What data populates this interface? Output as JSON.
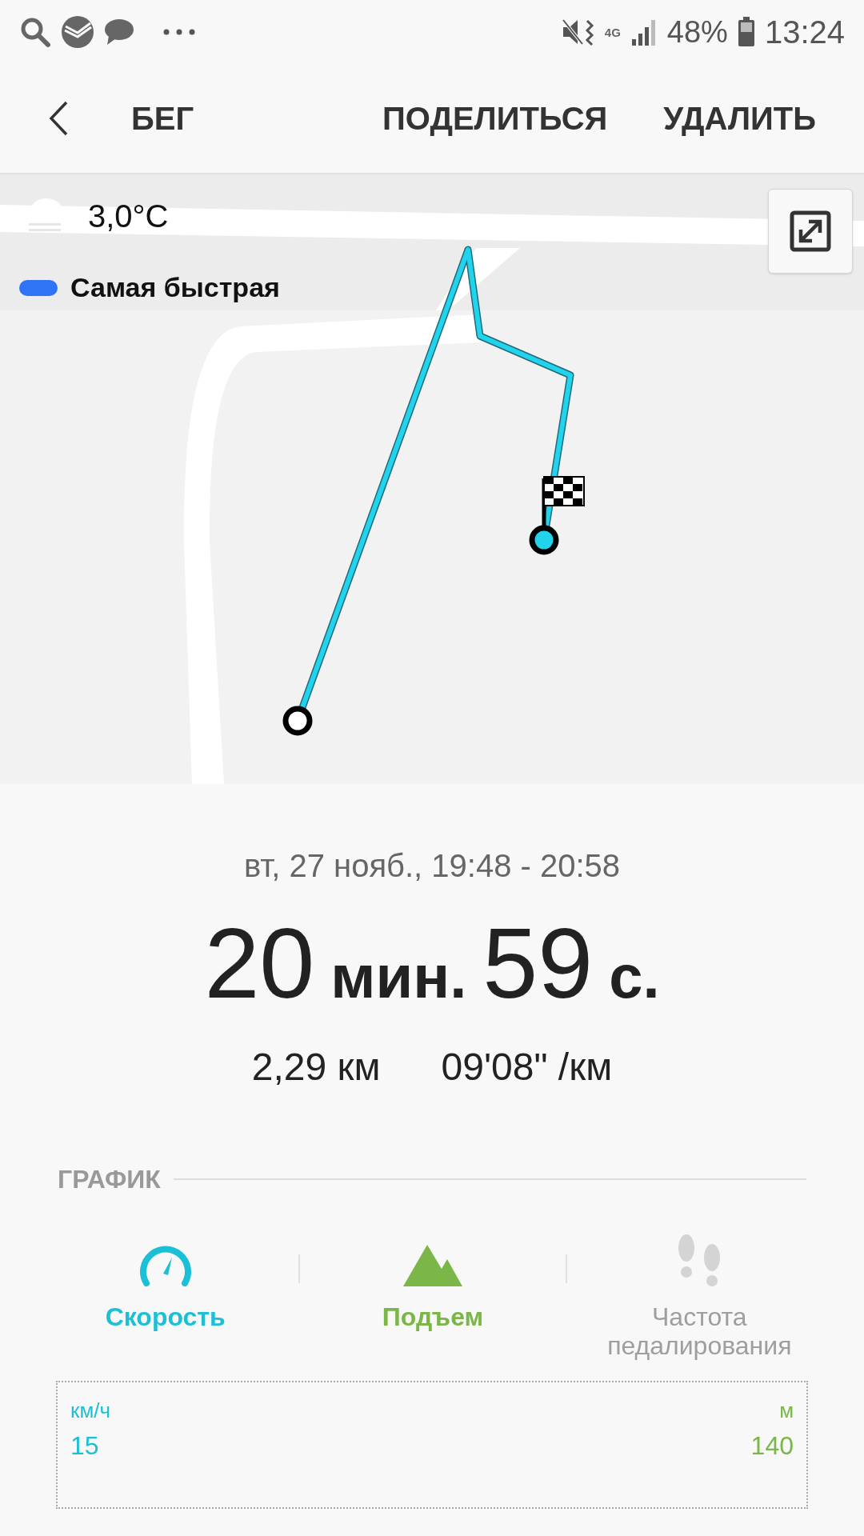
{
  "status_bar": {
    "battery": "48%",
    "time": "13:24",
    "network": "4G"
  },
  "header": {
    "title": "БЕГ",
    "actions": [
      "ПОДЕЛИТЬСЯ",
      "УДАЛИТЬ"
    ]
  },
  "map": {
    "temperature": "3,0°C",
    "legend": {
      "label": "Самая быстрая",
      "color": "#2f74f5"
    }
  },
  "summary": {
    "date": "вт, 27 нояб., 19:48 - 20:58",
    "duration": [
      {
        "value": "20",
        "unit": "мин."
      },
      {
        "value": "59",
        "unit": "с."
      }
    ],
    "distance": "2,29 км",
    "pace": "09'08\" /км"
  },
  "graph": {
    "title": "ГРАФИК",
    "metrics": [
      {
        "kind": "speed",
        "label": "Скорость",
        "selected": true,
        "color": "#1cc0d6"
      },
      {
        "kind": "elevation",
        "label": "Подъем",
        "selected": true,
        "color": "#7ab648"
      },
      {
        "kind": "cadence",
        "label": "Частота педалирования",
        "selected": false,
        "color": "#9e9e9e"
      }
    ],
    "left_unit": "км/ч",
    "left_tick": "15",
    "right_unit": "м",
    "right_tick": "140"
  }
}
